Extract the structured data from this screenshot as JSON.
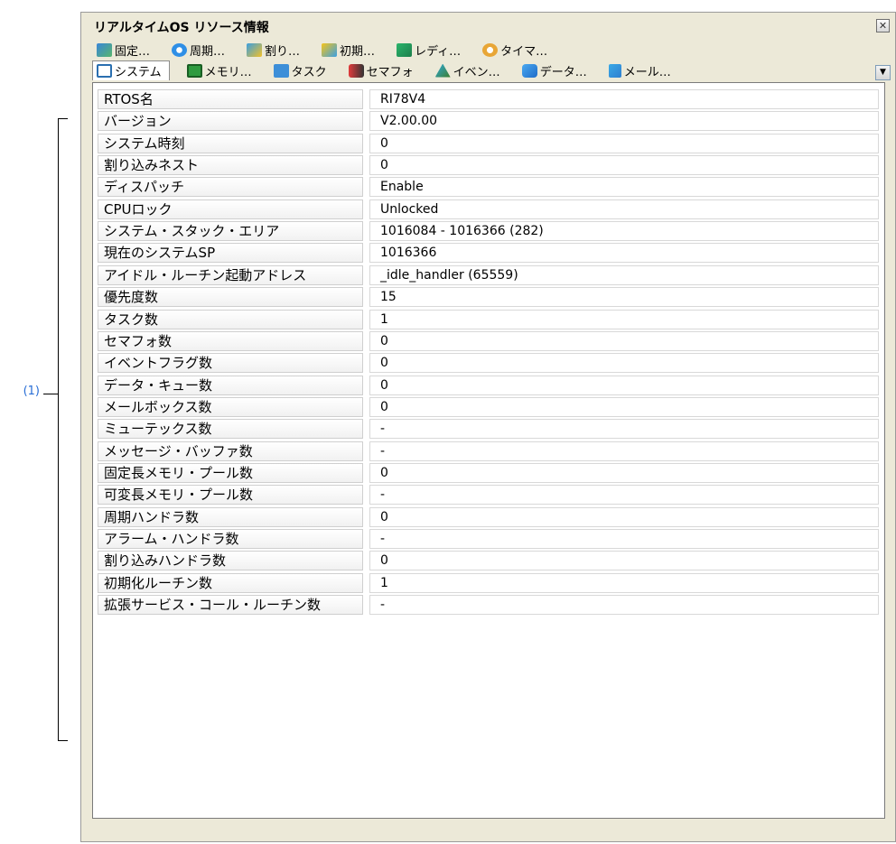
{
  "annotation": {
    "callout": "(1)"
  },
  "window": {
    "title": "リアルタイムOS リソース情報",
    "close_glyph": "✕"
  },
  "tabs_row1": [
    {
      "label": "固定…",
      "icon": "fixed-memory-icon"
    },
    {
      "label": "周期…",
      "icon": "cyclic-handler-icon"
    },
    {
      "label": "割り…",
      "icon": "interrupt-icon"
    },
    {
      "label": "初期…",
      "icon": "init-routine-icon"
    },
    {
      "label": "レディ…",
      "icon": "ready-queue-icon"
    },
    {
      "label": "タイマ…",
      "icon": "timer-icon"
    }
  ],
  "tabs_row2": [
    {
      "label": "システム",
      "icon": "system-icon",
      "active": true
    },
    {
      "label": "メモリ…",
      "icon": "memory-icon"
    },
    {
      "label": "タスク",
      "icon": "task-icon"
    },
    {
      "label": "セマフォ",
      "icon": "semaphore-icon"
    },
    {
      "label": "イベン…",
      "icon": "eventflag-icon"
    },
    {
      "label": "データ…",
      "icon": "dataqueue-icon"
    },
    {
      "label": "メール…",
      "icon": "mailbox-icon"
    }
  ],
  "properties": [
    {
      "name": "RTOS名",
      "value": "RI78V4"
    },
    {
      "name": "バージョン",
      "value": "V2.00.00"
    },
    {
      "name": "システム時刻",
      "value": "0"
    },
    {
      "name": "割り込みネスト",
      "value": "0"
    },
    {
      "name": "ディスパッチ",
      "value": "Enable"
    },
    {
      "name": "CPUロック",
      "value": "Unlocked"
    },
    {
      "name": "システム・スタック・エリア",
      "value": "1016084 - 1016366 (282)"
    },
    {
      "name": "現在のシステムSP",
      "value": "1016366"
    },
    {
      "name": "アイドル・ルーチン起動アドレス",
      "value": "_idle_handler (65559)"
    },
    {
      "name": "優先度数",
      "value": "15"
    },
    {
      "name": "タスク数",
      "value": "1"
    },
    {
      "name": "セマフォ数",
      "value": "0"
    },
    {
      "name": "イベントフラグ数",
      "value": "0"
    },
    {
      "name": "データ・キュー数",
      "value": "0"
    },
    {
      "name": "メールボックス数",
      "value": "0"
    },
    {
      "name": "ミューテックス数",
      "value": "-"
    },
    {
      "name": "メッセージ・バッファ数",
      "value": "-"
    },
    {
      "name": "固定長メモリ・プール数",
      "value": "0"
    },
    {
      "name": "可変長メモリ・プール数",
      "value": "-"
    },
    {
      "name": "周期ハンドラ数",
      "value": "0"
    },
    {
      "name": "アラーム・ハンドラ数",
      "value": "-"
    },
    {
      "name": "割り込みハンドラ数",
      "value": "0"
    },
    {
      "name": "初期化ルーチン数",
      "value": "1"
    },
    {
      "name": "拡張サービス・コール・ルーチン数",
      "value": "-"
    }
  ]
}
